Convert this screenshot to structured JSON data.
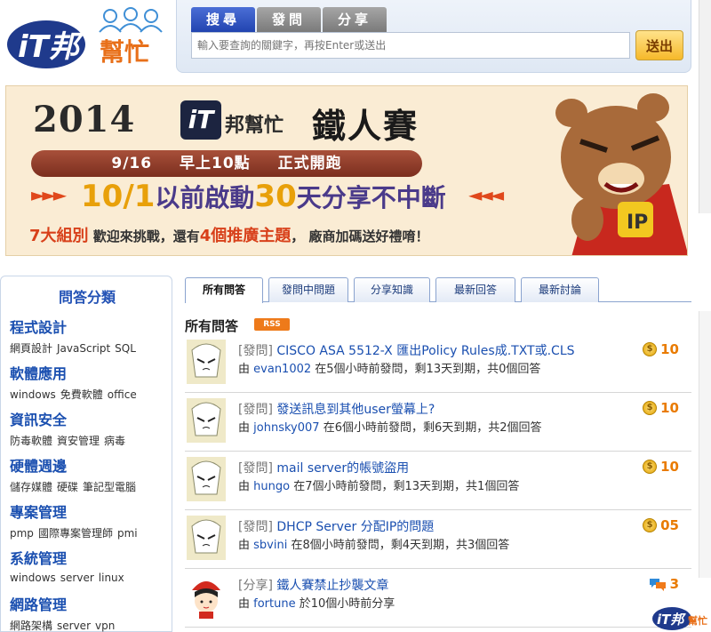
{
  "header": {
    "logo_text": "iT邦幫忙",
    "search_tabs": [
      "搜尋",
      "發問",
      "分享"
    ],
    "search_placeholder": "輸入要查詢的關鍵字，再按Enter或送出",
    "search_submit": "送出"
  },
  "banner": {
    "year": "2014",
    "logo_mark": "iT",
    "brand": "邦幫忙",
    "event": "鐵人賽",
    "date_part1": "9/16",
    "date_part2": "早上10點",
    "date_part3": "正式開跑",
    "arrows_left": "►►►",
    "arrows_right": "◄◄◄",
    "headline_num1": "10/1",
    "headline_text1": "以前啟動",
    "headline_num2": "30",
    "headline_text2": "天分享不中斷",
    "footline_em1": "7大組別",
    "footline_text1": " 歡迎來挑戰，還有",
    "footline_em2": "4個推廣主題",
    "footline_text2": "，  廠商加碼送好禮唷！"
  },
  "sidebar": {
    "title": "問答分類",
    "categories": [
      {
        "name": "程式設計",
        "tags": [
          "網頁設計",
          "JavaScript",
          "SQL"
        ]
      },
      {
        "name": "軟體應用",
        "tags": [
          "windows",
          "免費軟體",
          "office"
        ]
      },
      {
        "name": "資訊安全",
        "tags": [
          "防毒軟體",
          "資安管理",
          "病毒"
        ]
      },
      {
        "name": "硬體週邊",
        "tags": [
          "儲存媒體",
          "硬碟",
          "筆記型電腦"
        ]
      },
      {
        "name": "專案管理",
        "tags": [
          "pmp",
          "國際專案管理師",
          "pmi"
        ]
      },
      {
        "name": "系統管理",
        "tags": [
          "windows",
          "server",
          "linux"
        ]
      },
      {
        "name": "網路管理",
        "tags": [
          "網路架構",
          "server",
          "vpn"
        ]
      }
    ]
  },
  "main": {
    "tabs": [
      "所有問答",
      "發問中問題",
      "分享知識",
      "最新回答",
      "最新討論"
    ],
    "section_title": "所有問答",
    "rss_label": "RSS",
    "questions": [
      {
        "type": "[發問]",
        "title": "CISCO ASA 5512-X 匯出Policy Rules成.TXT或.CLS",
        "by": "由",
        "user": "evan1002",
        "meta": "在5個小時前發問，剩13天到期，共0個回答",
        "points": "10",
        "icon": "coin-icon"
      },
      {
        "type": "[發問]",
        "title": "發送訊息到其他user螢幕上?",
        "by": "由",
        "user": "johnsky007",
        "meta": "在6個小時前發問，剩6天到期，共2個回答",
        "points": "10",
        "icon": "coin-icon"
      },
      {
        "type": "[發問]",
        "title": "mail server的帳號盜用",
        "by": "由",
        "user": "hungo",
        "meta": "在7個小時前發問，剩13天到期，共1個回答",
        "points": "10",
        "icon": "coin-icon"
      },
      {
        "type": "[發問]",
        "title": "DHCP Server 分配IP的問題",
        "by": "由",
        "user": "sbvini",
        "meta": "在8個小時前發問，剩4天到期，共3個回答",
        "points": "05",
        "icon": "coin-icon"
      },
      {
        "type": "[分享]",
        "title": "鐵人賽禁止抄襲文章",
        "by": "由",
        "user": "fortune",
        "meta": "於10個小時前分享",
        "points": "3",
        "icon": "comment-icon"
      }
    ]
  },
  "corner_logo": "iT邦幫忙",
  "colors": {
    "link": "#1a4fb0",
    "points": "#e97b00",
    "accent": "#2144b0"
  }
}
